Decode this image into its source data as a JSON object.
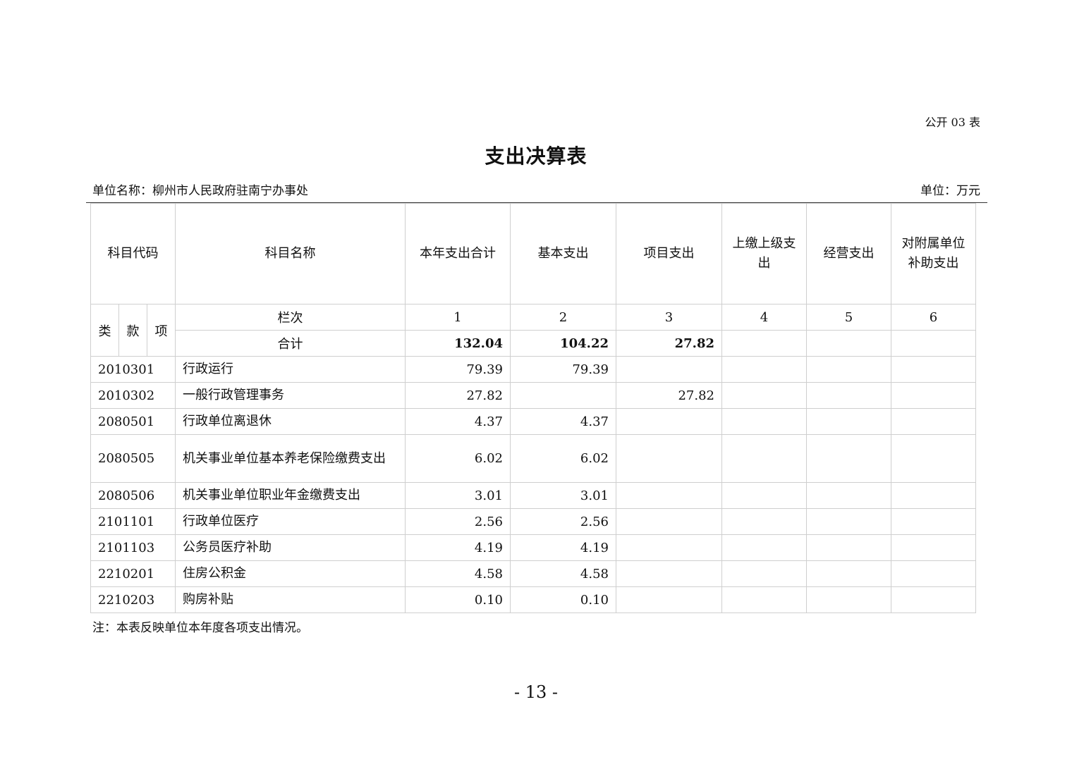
{
  "form_no": "公开 03 表",
  "title": "支出决算表",
  "unit_name": "单位名称：柳州市人民政府驻南宁办事处",
  "unit": "单位：万元",
  "headers": {
    "code": "科目代码",
    "name": "科目名称",
    "total": "本年支出合计",
    "basic": "基本支出",
    "project": "项目支出",
    "upper": "上缴上级支出",
    "business": "经营支出",
    "subsidy": "对附属单位补助支出"
  },
  "sub_headers": {
    "lei": "类",
    "kuan": "款",
    "xiang": "项"
  },
  "column_row": {
    "label": "栏次",
    "numbers": [
      "1",
      "2",
      "3",
      "4",
      "5",
      "6"
    ]
  },
  "total_row": {
    "label": "合计",
    "values": [
      "132.04",
      "104.22",
      "27.82",
      "",
      "",
      ""
    ]
  },
  "rows": [
    {
      "code": "2010301",
      "name": "行政运行",
      "values": [
        "79.39",
        "79.39",
        "",
        "",
        "",
        ""
      ]
    },
    {
      "code": "2010302",
      "name": "一般行政管理事务",
      "values": [
        "27.82",
        "",
        "27.82",
        "",
        "",
        ""
      ]
    },
    {
      "code": "2080501",
      "name": "行政单位离退休",
      "values": [
        "4.37",
        "4.37",
        "",
        "",
        "",
        ""
      ]
    },
    {
      "code": "2080505",
      "name": "机关事业单位基本养老保险缴费支出",
      "values": [
        "6.02",
        "6.02",
        "",
        "",
        "",
        ""
      ]
    },
    {
      "code": "2080506",
      "name": "机关事业单位职业年金缴费支出",
      "values": [
        "3.01",
        "3.01",
        "",
        "",
        "",
        ""
      ]
    },
    {
      "code": "2101101",
      "name": "行政单位医疗",
      "values": [
        "2.56",
        "2.56",
        "",
        "",
        "",
        ""
      ]
    },
    {
      "code": "2101103",
      "name": "公务员医疗补助",
      "values": [
        "4.19",
        "4.19",
        "",
        "",
        "",
        ""
      ]
    },
    {
      "code": "2210201",
      "name": "住房公积金",
      "values": [
        "4.58",
        "4.58",
        "",
        "",
        "",
        ""
      ]
    },
    {
      "code": "2210203",
      "name": "购房补贴",
      "values": [
        "0.10",
        "0.10",
        "",
        "",
        "",
        ""
      ]
    }
  ],
  "footnote": "注：本表反映单位本年度各项支出情况。",
  "page_number": "- 13 -"
}
